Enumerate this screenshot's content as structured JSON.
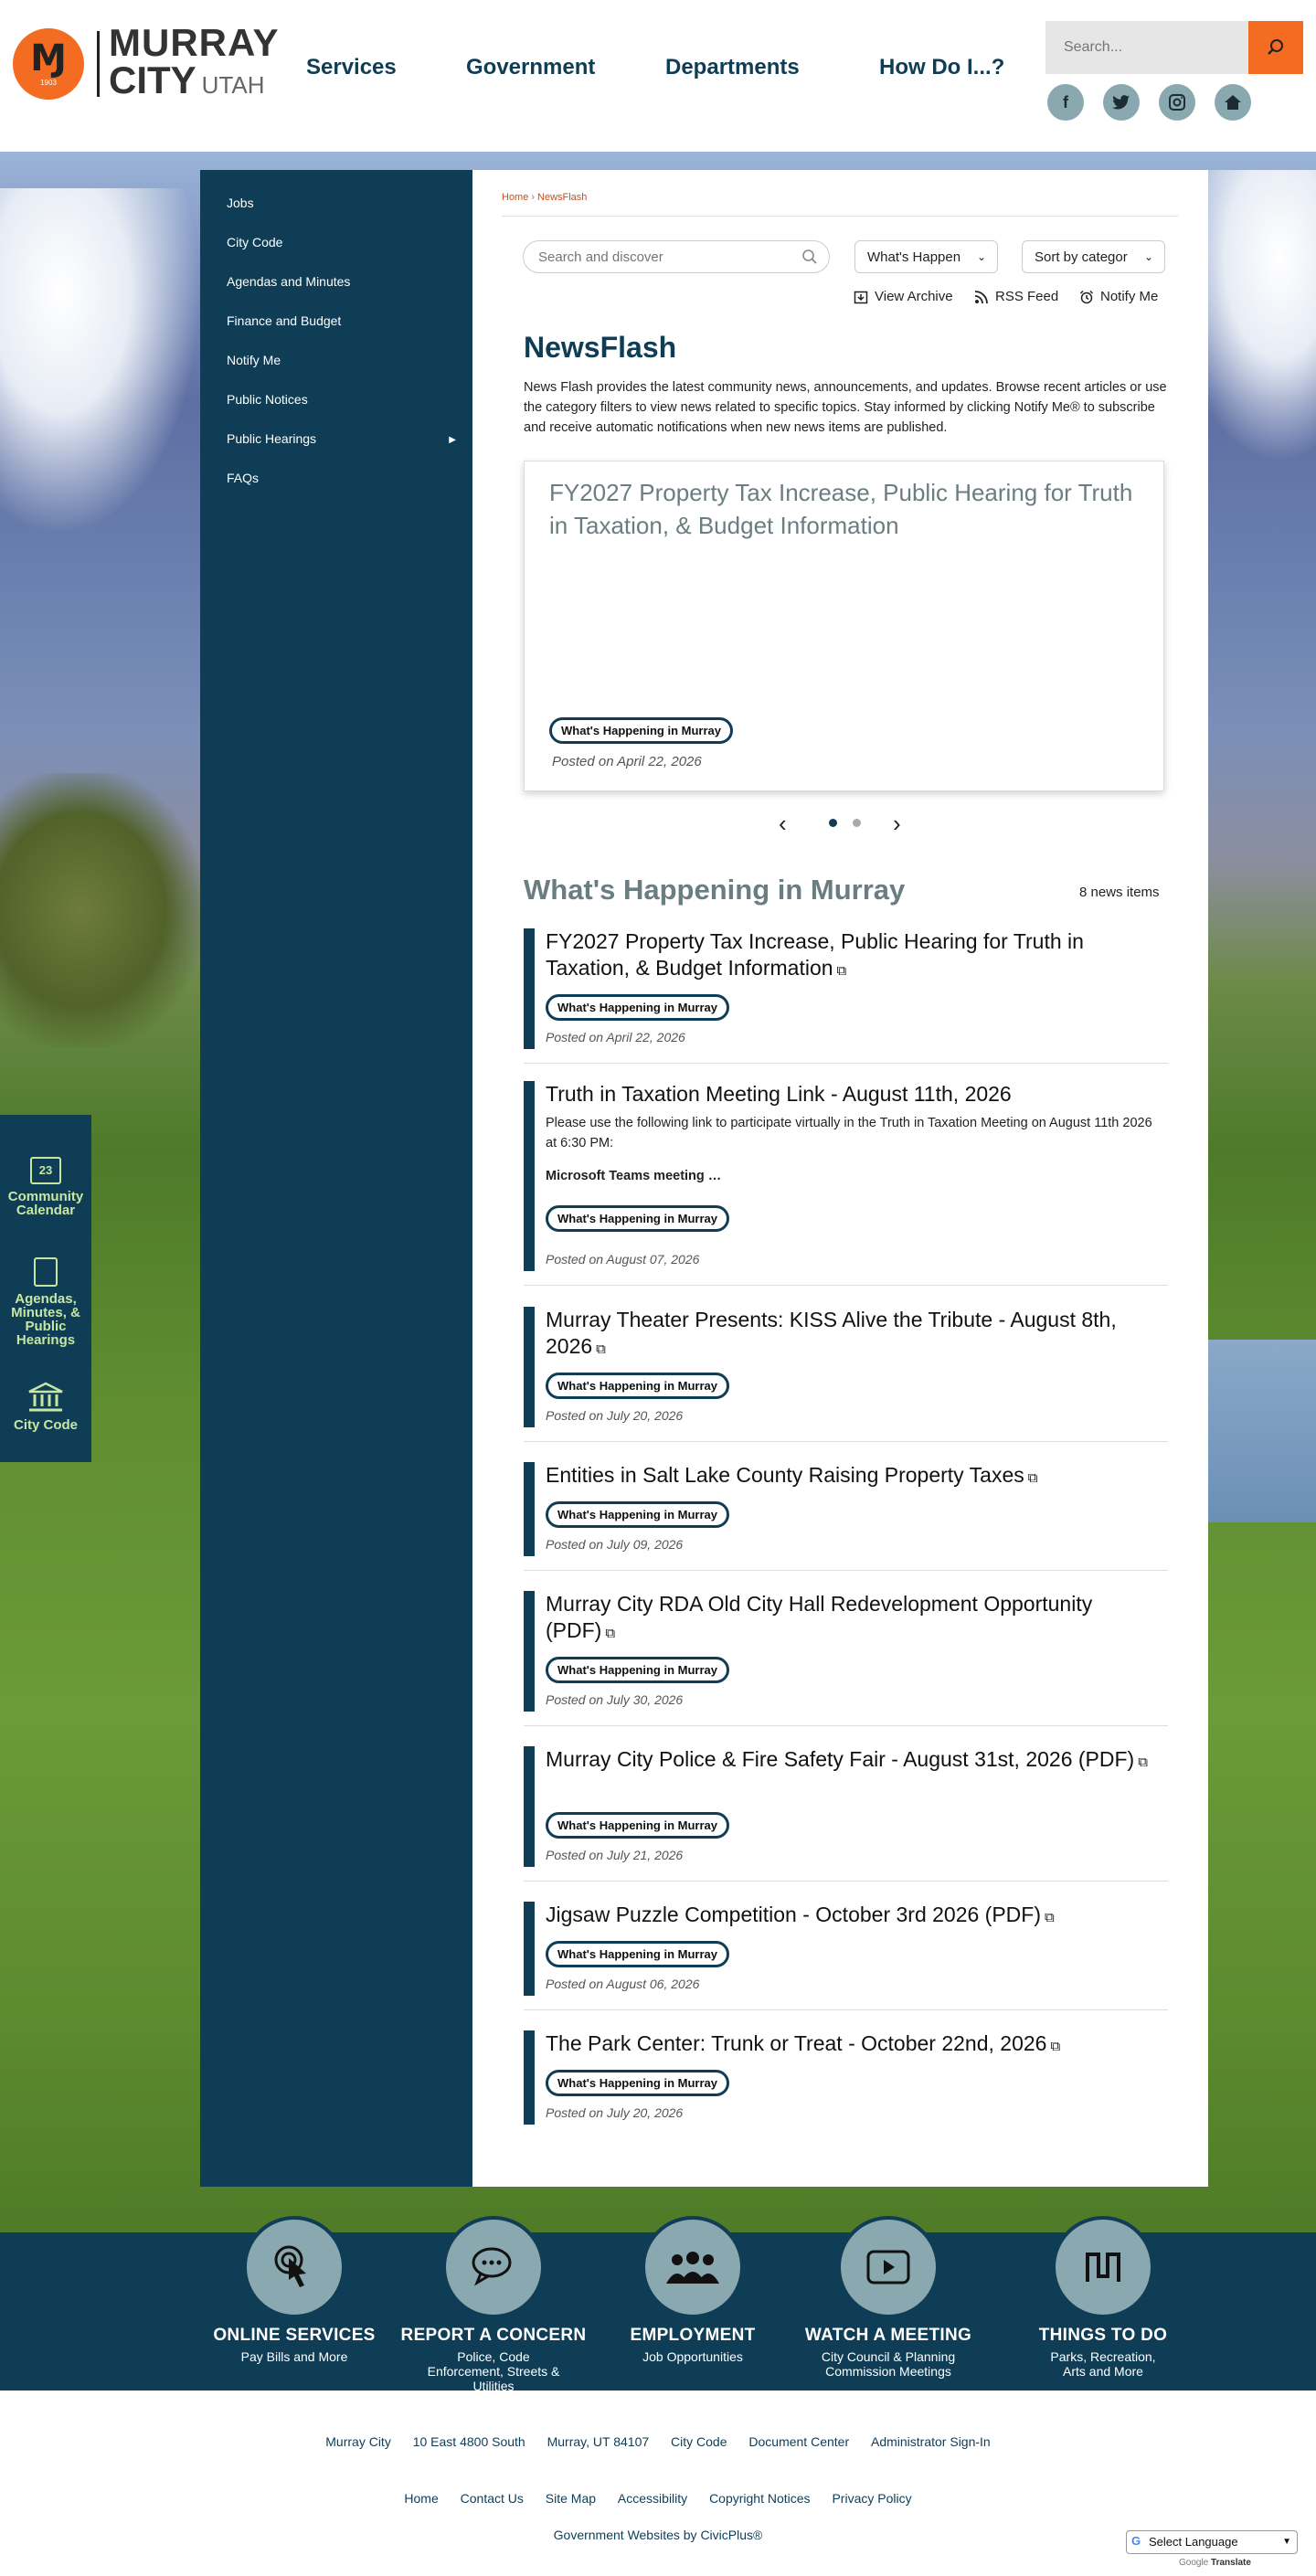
{
  "header": {
    "logo": {
      "line1": "MURRAY",
      "line2": "CITY",
      "state": "UTAH",
      "year": "1903"
    },
    "nav": [
      "Services",
      "Government",
      "Departments",
      "How Do I...?"
    ],
    "search_placeholder": "Search...",
    "social": [
      "facebook",
      "twitter",
      "instagram",
      "nextdoor"
    ]
  },
  "quick_links": [
    "Community Calendar",
    "Agendas, Minutes, & Public Hearings",
    "City Code"
  ],
  "quick_icons": {
    "calendar_day": "23"
  },
  "sidebar": {
    "items": [
      "Jobs",
      "City Code",
      "Agendas and Minutes",
      "Finance and Budget",
      "Notify Me",
      "Public Notices",
      "Public Hearings",
      "FAQs"
    ]
  },
  "breadcrumb": {
    "home": "Home",
    "sep": "›",
    "current": "NewsFlash"
  },
  "filters": {
    "search_placeholder": "Search and discover",
    "category_select": "What's Happen",
    "sort_select": "Sort by categor"
  },
  "tools": {
    "archive": "View Archive",
    "rss": "RSS Feed",
    "notify": "Notify Me"
  },
  "page": {
    "title": "NewsFlash",
    "description": "News Flash provides the latest community news, announcements, and updates. Browse recent articles or use the category filters to view news related to specific topics. Stay informed by clicking Notify Me® to subscribe and receive automatic notifications when new news items are published."
  },
  "featured": {
    "title": "FY2027 Property Tax Increase, Public Hearing for Truth in Taxation, & Budget Information",
    "category": "What's Happening in Murray",
    "date": "Posted on April 22, 2026"
  },
  "section": {
    "title": "What's Happening in Murray",
    "count": "8 news items"
  },
  "news": [
    {
      "title": "FY2027 Property Tax Increase, Public Hearing for Truth in Taxation, & Budget Information",
      "category": "What's Happening in Murray",
      "date": "Posted on April 22, 2026",
      "external": true
    },
    {
      "title": "Truth in Taxation Meeting Link - August 11th, 2026",
      "body": "Please use the following link to participate virtually in the Truth in Taxation Meeting on August 11th 2026 at 6:30 PM:",
      "more": "Microsoft Teams meeting …",
      "category": "What's Happening in Murray",
      "date": "Posted on August 07, 2026",
      "external": false
    },
    {
      "title": "Murray Theater Presents: KISS Alive the Tribute - August 8th, 2026",
      "category": "What's Happening in Murray",
      "date": "Posted on July 20, 2026",
      "external": true
    },
    {
      "title": "Entities in Salt Lake County Raising Property Taxes",
      "category": "What's Happening in Murray",
      "date": "Posted on July 09, 2026",
      "external": true
    },
    {
      "title": "Murray City RDA Old City Hall Redevelopment Opportunity (PDF)",
      "category": "What's Happening in Murray",
      "date": "Posted on July 30, 2026",
      "external": true
    },
    {
      "title": "Murray City Police & Fire Safety Fair - August 31st, 2026 (PDF)",
      "category": "What's Happening in Murray",
      "date": "Posted on July 21, 2026",
      "external": true
    },
    {
      "title": "Jigsaw Puzzle Competition - October 3rd 2026 (PDF)",
      "category": "What's Happening in Murray",
      "date": "Posted on August 06, 2026",
      "external": true
    },
    {
      "title": "The Park Center: Trunk or Treat - October 22nd, 2026",
      "category": "What's Happening in Murray",
      "date": "Posted on July 20, 2026",
      "external": true
    }
  ],
  "banner": [
    {
      "title": "ONLINE SERVICES",
      "sub": "Pay Bills and More",
      "icon": "hand-pointer-icon"
    },
    {
      "title": "REPORT A CONCERN",
      "sub": "Police, Code Enforcement, Streets & Utilities",
      "icon": "chat-bubbles-icon"
    },
    {
      "title": "EMPLOYMENT",
      "sub": "Job Opportunities",
      "icon": "people-icon"
    },
    {
      "title": "WATCH A MEETING",
      "sub": "City Council & Planning Commission Meetings",
      "icon": "video-play-icon"
    },
    {
      "title": "THINGS TO DO",
      "sub": "Parks, Recreation, Arts and More",
      "icon": "murray-logo-icon"
    }
  ],
  "footer": {
    "address": [
      "Murray City",
      "10 East 4800 South",
      "Murray, UT 84107",
      "City Code",
      "Document Center",
      "Administrator Sign-In"
    ],
    "links": [
      "Home",
      "Contact Us",
      "Site Map",
      "Accessibility",
      "Copyright Notices",
      "Privacy Policy"
    ],
    "credit": "Government Websites by CivicPlus®",
    "translate": "Select Language",
    "powered_by": "Google",
    "powered_translate": "Translate"
  },
  "colors": {
    "navy": "#0f3d56",
    "orange": "#f36c21",
    "social_bg": "#8aa8b0",
    "quick_text": "#c7e6a4"
  }
}
